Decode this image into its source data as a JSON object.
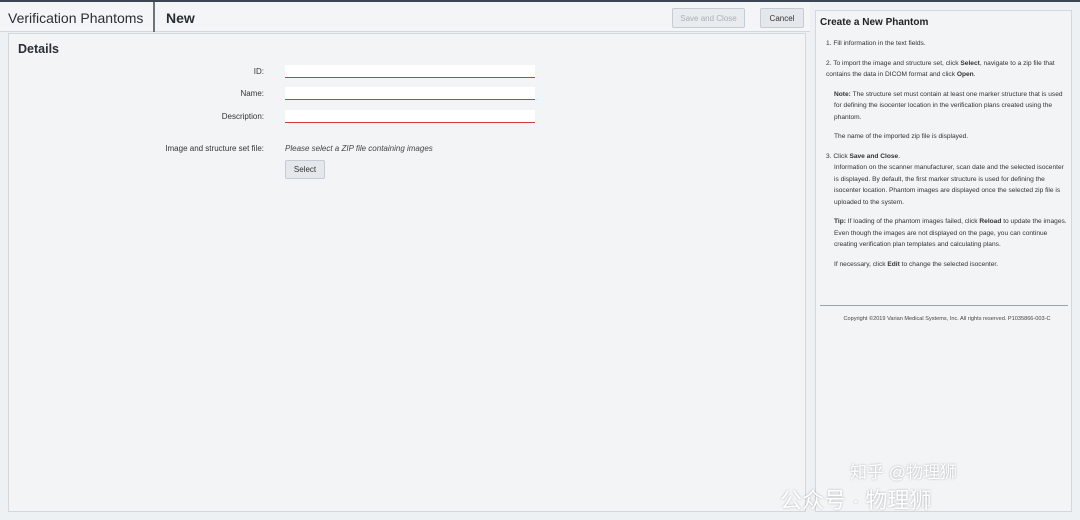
{
  "header": {
    "app_title": "Verification Phantoms",
    "page_title": "New",
    "save_close_label": "Save and Close",
    "cancel_label": "Cancel"
  },
  "details": {
    "title": "Details",
    "fields": [
      {
        "label": "ID:",
        "value": ""
      },
      {
        "label": "Name:",
        "value": ""
      },
      {
        "label": "Description:",
        "value": ""
      }
    ],
    "file_label": "Image and structure set file:",
    "file_hint": "Please select a ZIP file containing images",
    "select_label": "Select"
  },
  "help": {
    "title": "Create a New Phantom",
    "step1": "1. Fill information in the text fields.",
    "step2_a": "2. To import the image and structure set, click ",
    "step2_b": "Select",
    "step2_c": ", navigate to a zip file that contains the data in DICOM format and click ",
    "step2_d": "Open",
    "step2_e": ".",
    "note_label": "Note:",
    "note_text": " The structure set must contain at least one marker structure that is used for defining the isocenter location in the verification plans created using the phantom.",
    "imported_text": "The name of the imported zip file is displayed.",
    "step3_a": "3. Click ",
    "step3_b": "Save and Close",
    "step3_c": ".",
    "step3_info": "Information on the scanner manufacturer, scan date and the selected isocenter is displayed. By default, the first marker structure is used for defining the isocenter location. Phantom images are displayed once the selected zip file is uploaded to the system.",
    "tip_label": "Tip:",
    "tip_text_a": " If loading of the phantom images failed, click ",
    "tip_text_b": "Reload",
    "tip_text_c": " to update the images. Even though the images are not displayed on the page, you can continue creating verification plan templates and calculating plans.",
    "edit_a": "If necessary, click ",
    "edit_b": "Edit",
    "edit_c": " to change the selected isocenter.",
    "copyright": "Copyright ©2019 Varian Medical Systems, Inc. All rights reserved. P1035866-003-C"
  },
  "watermark": {
    "line1": "知乎 @物理狮",
    "line2": "公众号 · 物理狮"
  }
}
